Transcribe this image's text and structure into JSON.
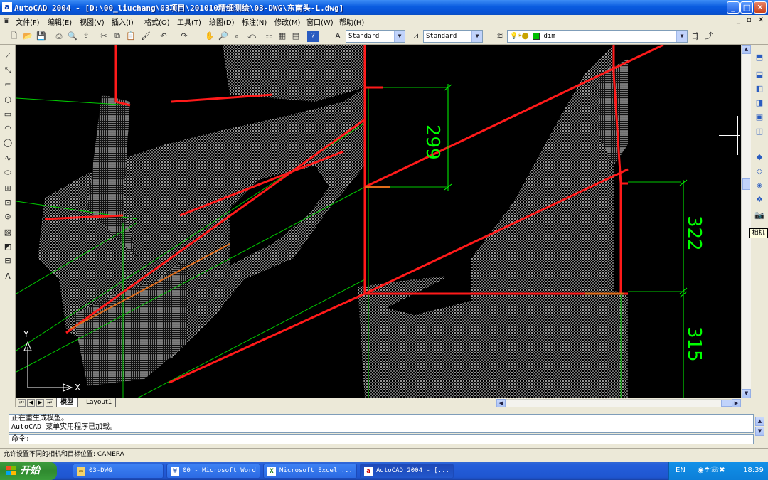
{
  "window": {
    "app_icon": "a",
    "title": "AutoCAD 2004 - [D:\\00_liuchang\\03项目\\201010精细测绘\\03-DWG\\东南头-L.dwg]",
    "controls": {
      "minimize": "_",
      "maximize": "□",
      "close": "✕"
    }
  },
  "menu": {
    "items": [
      "文件(F)",
      "编辑(E)",
      "视图(V)",
      "插入(I)",
      "格式(O)",
      "工具(T)",
      "绘图(D)",
      "标注(N)",
      "修改(M)",
      "窗口(W)",
      "帮助(H)"
    ],
    "doc_controls": [
      "_",
      "▫",
      "✕"
    ]
  },
  "toolbar": {
    "text_style": "Standard",
    "dim_style": "Standard",
    "layer": "dim",
    "layer_color": "#00c000"
  },
  "canvas": {
    "dimensions": [
      "299",
      "322",
      "315"
    ],
    "dim_color": "#00ff00",
    "ucs_y": "Y",
    "ucs_x": "X"
  },
  "tabs": {
    "model": "模型",
    "layout": "Layout1"
  },
  "tooltip": "相机",
  "command": {
    "history": [
      "正在重生成模型。",
      "AutoCAD 菜单实用程序已加载。"
    ],
    "prompt": "命令:"
  },
  "status": {
    "text": "允许设置不同的相机和目标位置:  CAMERA"
  },
  "taskbar": {
    "start": "开始",
    "tasks": [
      {
        "label": "03-DWG",
        "icon": "folder-icon"
      },
      {
        "label": "00 - Microsoft Word",
        "icon": "word-icon"
      },
      {
        "label": "Microsoft Excel ...",
        "icon": "excel-icon"
      },
      {
        "label": "AutoCAD 2004 - [...",
        "icon": "autocad-icon"
      }
    ],
    "lang": "EN",
    "time": "18:39"
  }
}
